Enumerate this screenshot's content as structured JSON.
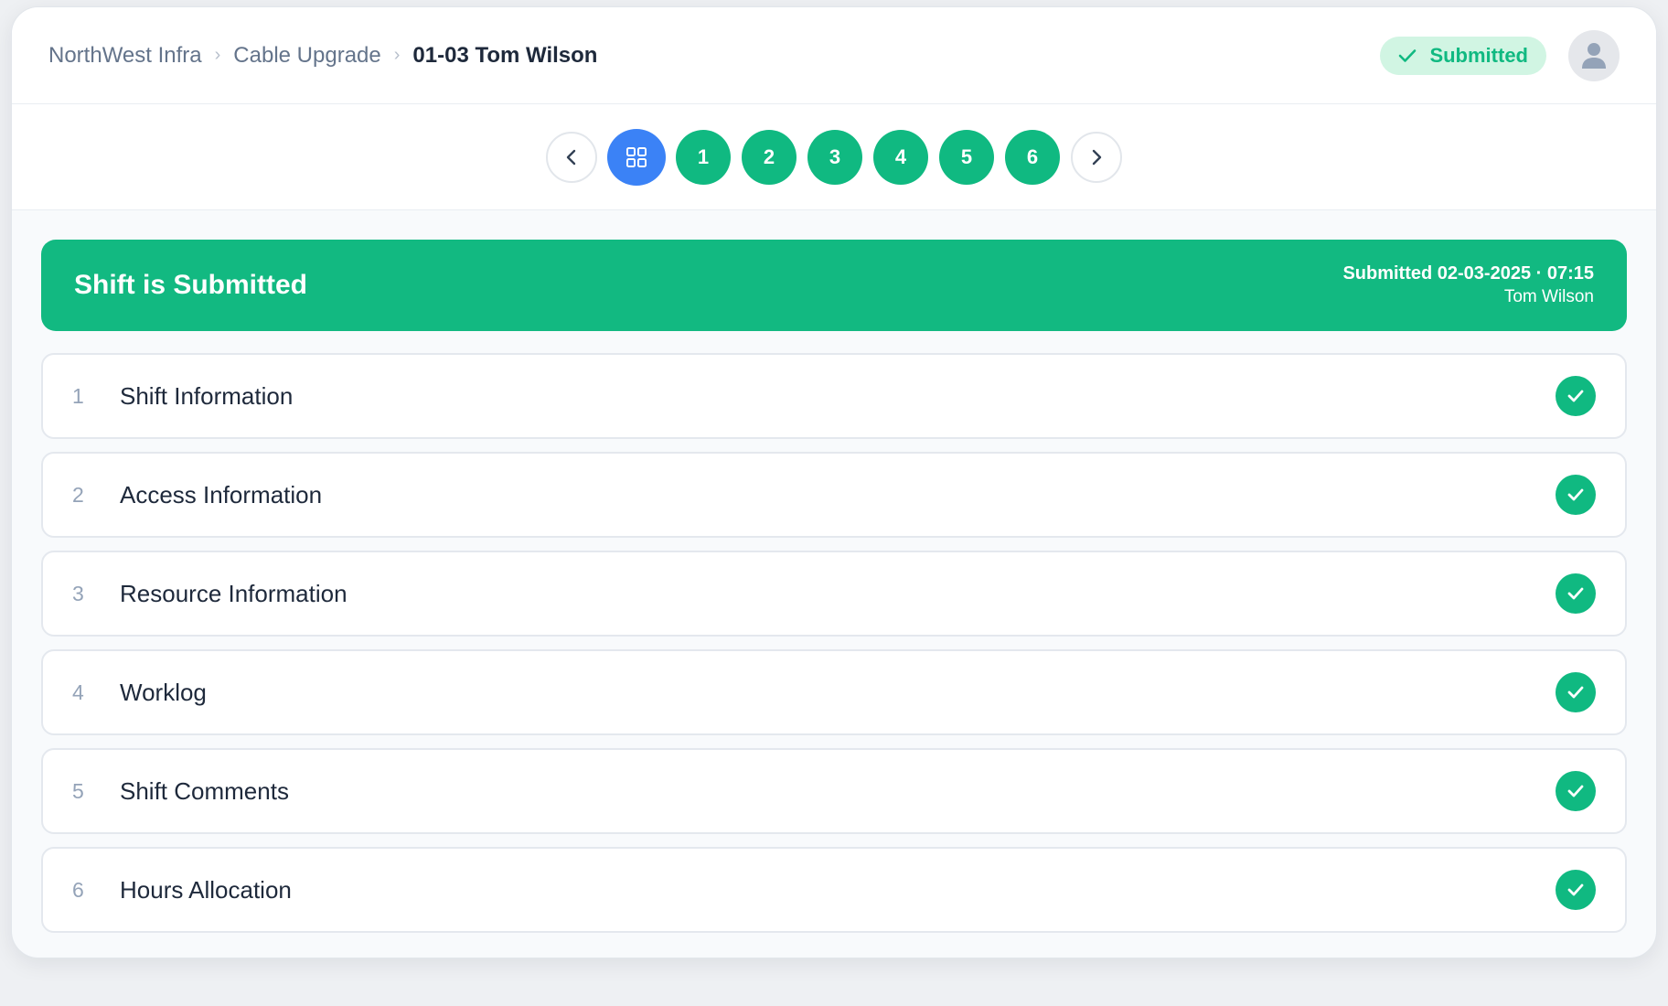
{
  "breadcrumb": {
    "org": "NorthWest Infra",
    "project": "Cable Upgrade",
    "current": "01-03 Tom Wilson"
  },
  "status": {
    "label": "Submitted",
    "color": "#10b981"
  },
  "stepper": {
    "steps": [
      "1",
      "2",
      "3",
      "4",
      "5",
      "6"
    ],
    "active_color": "#3b82f6",
    "done_color": "#10b981"
  },
  "banner": {
    "title": "Shift is Submitted",
    "submitted_at": "Submitted 02-03-2025 · 07:15",
    "submitted_by": "Tom Wilson"
  },
  "sections": [
    {
      "num": "1",
      "title": "Shift Information",
      "icon": "check-icon"
    },
    {
      "num": "2",
      "title": "Access Information",
      "icon": "check-icon"
    },
    {
      "num": "3",
      "title": "Resource Information",
      "icon": "check-icon"
    },
    {
      "num": "4",
      "title": "Worklog",
      "icon": "check-icon"
    },
    {
      "num": "5",
      "title": "Shift Comments",
      "icon": "check-icon"
    },
    {
      "num": "6",
      "title": "Hours Allocation",
      "icon": "check-icon"
    }
  ]
}
